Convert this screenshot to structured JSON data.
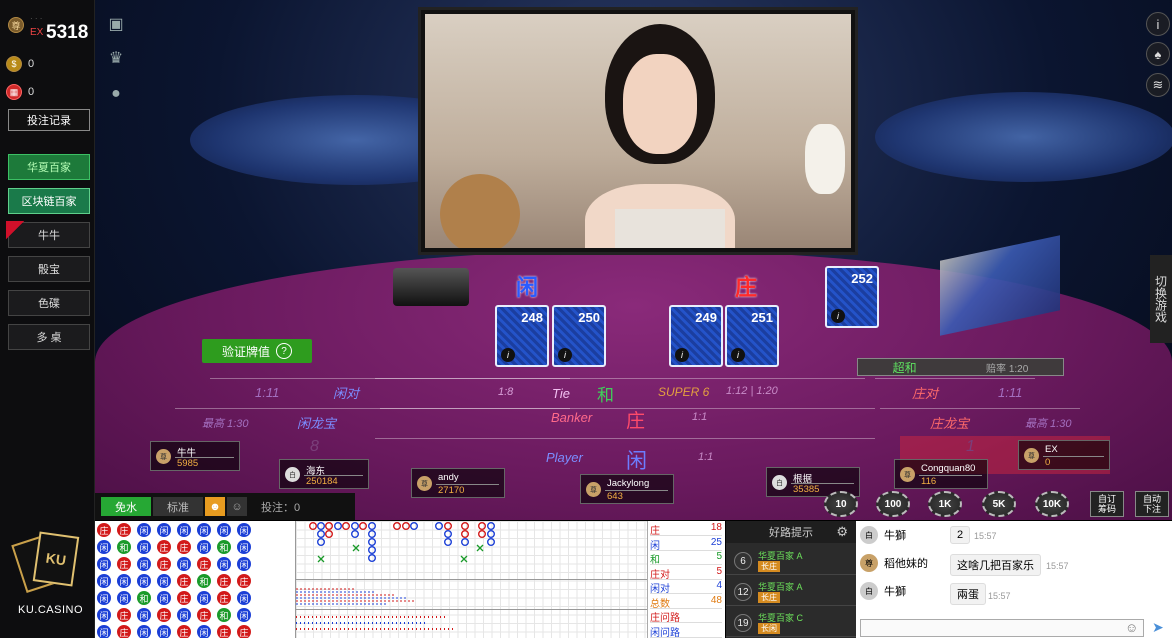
{
  "account": {
    "name_masked": "·  ·  ·",
    "ex_tag": "EX",
    "balance": "5318",
    "gold": "0",
    "gift": "0",
    "record_button": "投注记录"
  },
  "games": [
    {
      "label": "华夏百家"
    },
    {
      "label": "区块链百家"
    },
    {
      "label": "牛牛"
    },
    {
      "label": "骰宝"
    },
    {
      "label": "色碟"
    },
    {
      "label": "多 桌"
    }
  ],
  "logo": {
    "text": "KU.CASINO"
  },
  "table": {
    "player_title": "闲",
    "banker_title": "庄",
    "cards": {
      "p1": "248",
      "p2": "250",
      "b1": "249",
      "b2": "251",
      "extra": "252"
    },
    "card_icon": "i",
    "verify_label": "验证牌值",
    "verify_q": "?",
    "super_label": "超和",
    "super_odds": "赔率 1:20",
    "zones": {
      "player_pair": "闲对",
      "player_pair_odds": "1:11",
      "player_dragon": "闲龙宝",
      "player_dragon_odds": "最高 1:30",
      "tie_en": "Tie",
      "tie_cn": "和",
      "tie_odds": "1:8",
      "super6": "SUPER 6",
      "super6_odds": "1:12 | 1:20",
      "banker_pair": "庄对",
      "banker_pair_odds": "1:11",
      "banker_dragon": "庄龙宝",
      "banker_dragon_odds": "最高 1:30",
      "banker_en": "Banker",
      "banker_cn": "庄",
      "banker_odds": "1:1",
      "player_en": "Player",
      "player_cn": "闲",
      "player_odds": "1:1",
      "seat8": "8",
      "seat1": "1"
    }
  },
  "seats": [
    {
      "name": "牛牛",
      "amount": "5985"
    },
    {
      "name": "海东",
      "amount": "250184"
    },
    {
      "name": "andy",
      "amount": "27170"
    },
    {
      "name": "Jackylong",
      "amount": "643"
    },
    {
      "name": "根据",
      "amount": "35385"
    },
    {
      "name": "Congquan80",
      "amount": "116"
    },
    {
      "name": "EX",
      "amount": "0"
    }
  ],
  "controls": {
    "free_water": "免水",
    "standard": "标准",
    "bet_label": "投注：0",
    "chips": [
      "10",
      "100",
      "1K",
      "5K",
      "10K"
    ],
    "custom_chip": "自订\n筹码",
    "auto_bet": "自动\n下注",
    "switch_game": "切换游戏"
  },
  "stats": [
    {
      "label": "庄",
      "value": "18"
    },
    {
      "label": "闲",
      "value": "25"
    },
    {
      "label": "和",
      "value": "5"
    },
    {
      "label": "庄对",
      "value": "5"
    },
    {
      "label": "闲对",
      "value": "4"
    },
    {
      "label": "总数",
      "value": "48"
    },
    {
      "label": "庄问路",
      "value": ""
    },
    {
      "label": "闲问路",
      "value": ""
    }
  ],
  "hints": {
    "title": "好路提示",
    "rows": [
      {
        "num": "6",
        "table": "华夏百家 A",
        "tag": "长庄"
      },
      {
        "num": "12",
        "table": "华夏百家 A",
        "tag": "长庄"
      },
      {
        "num": "19",
        "table": "华夏百家 C",
        "tag": "长闲"
      }
    ]
  },
  "chat": {
    "messages": [
      {
        "user": "牛獅",
        "text": "2",
        "time": "15:57"
      },
      {
        "user": "稻他妹的",
        "text": "这啥几把百家乐",
        "time": "15:57"
      },
      {
        "user": "牛獅",
        "text": "兩蛋",
        "time": "15:57"
      }
    ]
  },
  "bead_road": [
    [
      "庄",
      "庄",
      "闲",
      "闲",
      "闲",
      "闲",
      "闲",
      "闲"
    ],
    [
      "闲",
      "和",
      "闲",
      "庄",
      "庄",
      "闲",
      "和",
      "闲"
    ],
    [
      "闲",
      "庄",
      "闲",
      "庄",
      "闲",
      "庄",
      "闲",
      "闲"
    ],
    [
      "闲",
      "闲",
      "闲",
      "闲",
      "庄",
      "和",
      "庄",
      "庄"
    ],
    [
      "闲",
      "闲",
      "和",
      "闲",
      "庄",
      "闲",
      "庄",
      "闲"
    ],
    [
      "闲",
      "庄",
      "闲",
      "庄",
      "闲",
      "庄",
      "和",
      "闲"
    ],
    [
      "闲",
      "庄",
      "闲",
      "闲",
      "庄",
      "闲",
      "庄",
      "庄"
    ]
  ],
  "colors": {
    "banker": "#d21a1a",
    "player": "#1b3fd6",
    "tie": "#1a9a2a"
  }
}
